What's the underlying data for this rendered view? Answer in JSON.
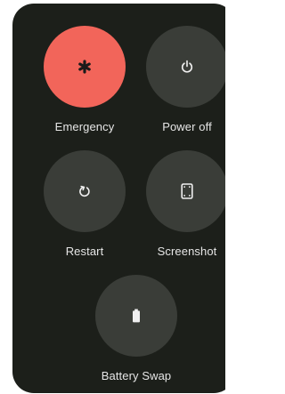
{
  "power_menu": {
    "items": [
      {
        "label": "Emergency",
        "icon": "emergency-asterisk-icon",
        "color": "#f2655a"
      },
      {
        "label": "Power off",
        "icon": "power-icon"
      },
      {
        "label": "Restart",
        "icon": "restart-icon"
      },
      {
        "label": "Screenshot",
        "icon": "screenshot-phone-icon"
      },
      {
        "label": "Battery Swap",
        "icon": "battery-icon"
      }
    ]
  },
  "colors": {
    "panel_background": "#1c1f1a",
    "button_background": "#3a3d38",
    "emergency_accent": "#f2655a",
    "label_text": "#e6e6e6"
  }
}
